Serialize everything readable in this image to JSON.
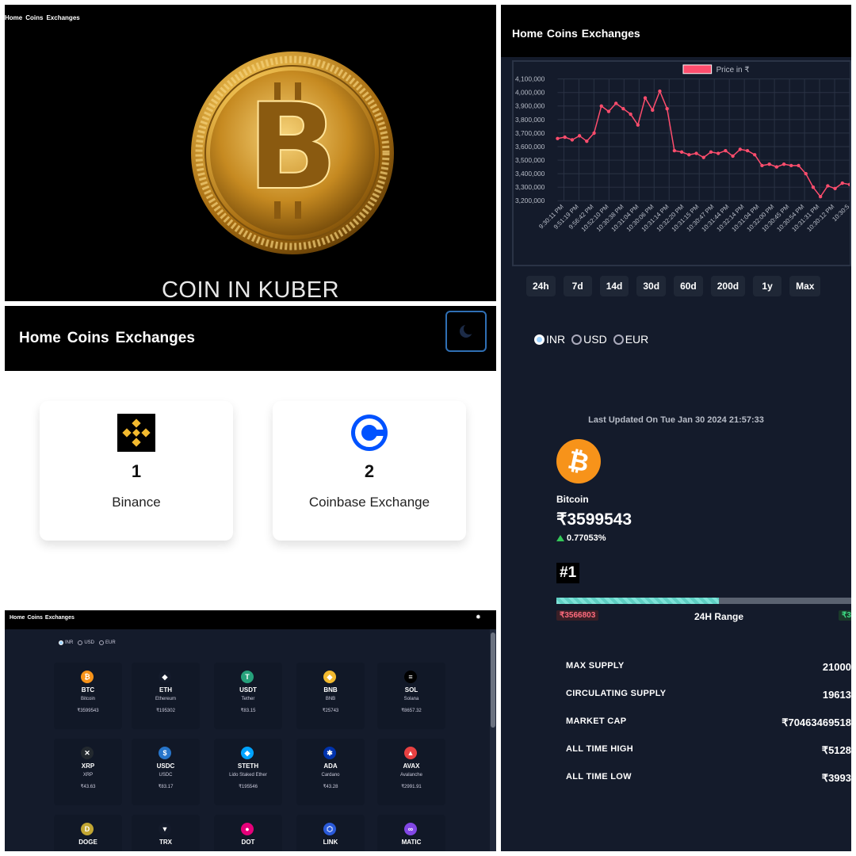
{
  "nav": {
    "home": "Home",
    "coins": "Coins",
    "exchanges": "Exchanges"
  },
  "hero": {
    "title": "COIN IN KUBER"
  },
  "exchanges": [
    {
      "rank": "1",
      "name": "Binance",
      "icon": "binance-logo"
    },
    {
      "rank": "2",
      "name": "Coinbase Exchange",
      "icon": "coinbase-logo"
    }
  ],
  "currency": {
    "options": [
      "INR",
      "USD",
      "EUR"
    ],
    "selected": "INR"
  },
  "coins": [
    {
      "symbol": "BTC",
      "name": "Bitcoin",
      "price": "₹3599543",
      "icon": "bitcoin-icon",
      "color": "#f7931a",
      "glyph": "₿"
    },
    {
      "symbol": "ETH",
      "name": "Ethereum",
      "price": "₹195302",
      "icon": "ethereum-icon",
      "color": "#141b2b",
      "glyph": "◆"
    },
    {
      "symbol": "USDT",
      "name": "Tether",
      "price": "₹83.15",
      "icon": "tether-icon",
      "color": "#26a17b",
      "glyph": "T"
    },
    {
      "symbol": "BNB",
      "name": "BNB",
      "price": "₹25743",
      "icon": "bnb-icon",
      "color": "#f3ba2f",
      "glyph": "◆"
    },
    {
      "symbol": "SOL",
      "name": "Solana",
      "price": "₹8657.32",
      "icon": "solana-icon",
      "color": "#000000",
      "glyph": "≡"
    },
    {
      "symbol": "XRP",
      "name": "XRP",
      "price": "₹43.63",
      "icon": "xrp-icon",
      "color": "#23292f",
      "glyph": "✕"
    },
    {
      "symbol": "USDC",
      "name": "USDC",
      "price": "₹83.17",
      "icon": "usdc-icon",
      "color": "#2775ca",
      "glyph": "$"
    },
    {
      "symbol": "STETH",
      "name": "Lido Staked Ether",
      "price": "₹195546",
      "icon": "steth-icon",
      "color": "#00a3ff",
      "glyph": "◆"
    },
    {
      "symbol": "ADA",
      "name": "Cardano",
      "price": "₹43.28",
      "icon": "cardano-icon",
      "color": "#0033ad",
      "glyph": "✱"
    },
    {
      "symbol": "AVAX",
      "name": "Avalanche",
      "price": "₹2991.91",
      "icon": "avalanche-icon",
      "color": "#e84142",
      "glyph": "▲"
    },
    {
      "symbol": "DOGE",
      "name": "",
      "price": "",
      "icon": "dogecoin-icon",
      "color": "#c2a633",
      "glyph": "D"
    },
    {
      "symbol": "TRX",
      "name": "",
      "price": "",
      "icon": "tron-icon",
      "color": "#141b2b",
      "glyph": "▼"
    },
    {
      "symbol": "DOT",
      "name": "",
      "price": "",
      "icon": "polkadot-icon",
      "color": "#e6007a",
      "glyph": "●"
    },
    {
      "symbol": "LINK",
      "name": "",
      "price": "",
      "icon": "chainlink-icon",
      "color": "#2a5ada",
      "glyph": "⬡"
    },
    {
      "symbol": "MATIC",
      "name": "",
      "price": "",
      "icon": "polygon-icon",
      "color": "#8247e5",
      "glyph": "∞"
    }
  ],
  "chart_data": {
    "type": "line",
    "legend": "Price in ₹",
    "legend_color": "#ff4d6d",
    "ylim": [
      3200000,
      4100000
    ],
    "yticks": [
      "4,100,000",
      "4,000,000",
      "3,900,000",
      "3,800,000",
      "3,700,000",
      "3,600,000",
      "3,500,000",
      "3,400,000",
      "3,300,000",
      "3,200,000"
    ],
    "xticks": [
      "9:30:11 PM",
      "9:51:19 PM",
      "9:56:42 PM",
      "10:52:10 PM",
      "10:30:38 PM",
      "10:31:04 PM",
      "10:30:06 PM",
      "10:31:14 PM",
      "10:32:20 PM",
      "10:31:15 PM",
      "10:30:47 PM",
      "10:31:44 PM",
      "10:32:14 PM",
      "10:31:04 PM",
      "10:32:00 PM",
      "10:30:45 PM",
      "10:30:54 PM",
      "10:31:31 PM",
      "10:30:12 PM",
      "10:30:5"
    ],
    "values": [
      3660000,
      3670000,
      3650000,
      3680000,
      3640000,
      3700000,
      3900000,
      3860000,
      3920000,
      3880000,
      3840000,
      3760000,
      3960000,
      3870000,
      4010000,
      3880000,
      3570000,
      3560000,
      3540000,
      3550000,
      3520000,
      3560000,
      3550000,
      3570000,
      3530000,
      3580000,
      3570000,
      3540000,
      3460000,
      3470000,
      3450000,
      3470000,
      3460000,
      3460000,
      3400000,
      3300000,
      3230000,
      3310000,
      3290000,
      3330000,
      3320000
    ]
  },
  "timeframes": [
    "24h",
    "7d",
    "14d",
    "30d",
    "60d",
    "200d",
    "1y",
    "Max"
  ],
  "detail": {
    "updated": "Last Updated On Tue Jan 30 2024 21:57:33",
    "name": "Bitcoin",
    "price": "₹3599543",
    "change": "0.77053%",
    "rank": "#1",
    "range_label": "24H Range",
    "range_low": "₹3566803",
    "range_high": "₹3",
    "range_fraction": 0.55,
    "stats": [
      {
        "key": "MAX SUPPLY",
        "value": "21000"
      },
      {
        "key": "CIRCULATING SUPPLY",
        "value": "19613"
      },
      {
        "key": "MARKET CAP",
        "value": "₹70463469518"
      },
      {
        "key": "ALL TIME HIGH",
        "value": "₹5128"
      },
      {
        "key": "ALL TIME LOW",
        "value": "₹3993"
      }
    ]
  }
}
